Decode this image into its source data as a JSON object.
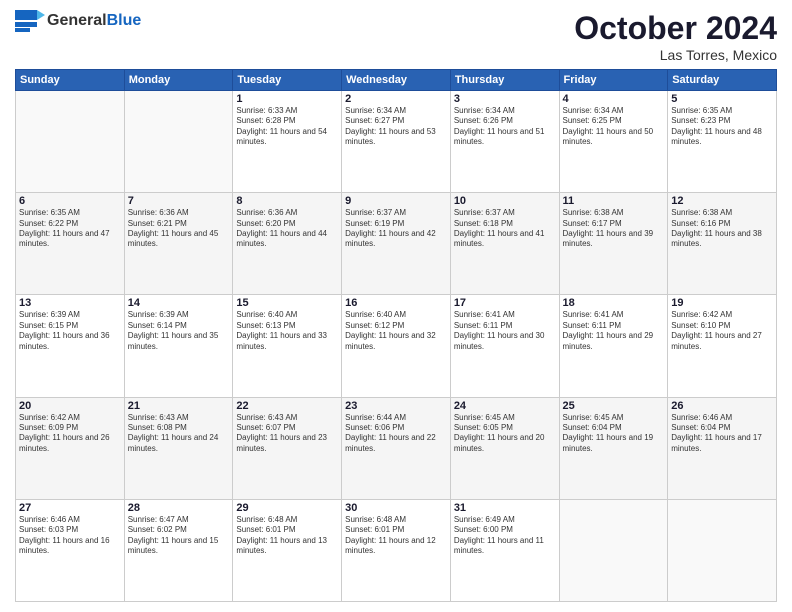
{
  "logo": {
    "general": "General",
    "blue": "Blue"
  },
  "title": "October 2024",
  "location": "Las Torres, Mexico",
  "days_header": [
    "Sunday",
    "Monday",
    "Tuesday",
    "Wednesday",
    "Thursday",
    "Friday",
    "Saturday"
  ],
  "weeks": [
    [
      {
        "day": "",
        "info": ""
      },
      {
        "day": "",
        "info": ""
      },
      {
        "day": "1",
        "info": "Sunrise: 6:33 AM\nSunset: 6:28 PM\nDaylight: 11 hours and 54 minutes."
      },
      {
        "day": "2",
        "info": "Sunrise: 6:34 AM\nSunset: 6:27 PM\nDaylight: 11 hours and 53 minutes."
      },
      {
        "day": "3",
        "info": "Sunrise: 6:34 AM\nSunset: 6:26 PM\nDaylight: 11 hours and 51 minutes."
      },
      {
        "day": "4",
        "info": "Sunrise: 6:34 AM\nSunset: 6:25 PM\nDaylight: 11 hours and 50 minutes."
      },
      {
        "day": "5",
        "info": "Sunrise: 6:35 AM\nSunset: 6:23 PM\nDaylight: 11 hours and 48 minutes."
      }
    ],
    [
      {
        "day": "6",
        "info": "Sunrise: 6:35 AM\nSunset: 6:22 PM\nDaylight: 11 hours and 47 minutes."
      },
      {
        "day": "7",
        "info": "Sunrise: 6:36 AM\nSunset: 6:21 PM\nDaylight: 11 hours and 45 minutes."
      },
      {
        "day": "8",
        "info": "Sunrise: 6:36 AM\nSunset: 6:20 PM\nDaylight: 11 hours and 44 minutes."
      },
      {
        "day": "9",
        "info": "Sunrise: 6:37 AM\nSunset: 6:19 PM\nDaylight: 11 hours and 42 minutes."
      },
      {
        "day": "10",
        "info": "Sunrise: 6:37 AM\nSunset: 6:18 PM\nDaylight: 11 hours and 41 minutes."
      },
      {
        "day": "11",
        "info": "Sunrise: 6:38 AM\nSunset: 6:17 PM\nDaylight: 11 hours and 39 minutes."
      },
      {
        "day": "12",
        "info": "Sunrise: 6:38 AM\nSunset: 6:16 PM\nDaylight: 11 hours and 38 minutes."
      }
    ],
    [
      {
        "day": "13",
        "info": "Sunrise: 6:39 AM\nSunset: 6:15 PM\nDaylight: 11 hours and 36 minutes."
      },
      {
        "day": "14",
        "info": "Sunrise: 6:39 AM\nSunset: 6:14 PM\nDaylight: 11 hours and 35 minutes."
      },
      {
        "day": "15",
        "info": "Sunrise: 6:40 AM\nSunset: 6:13 PM\nDaylight: 11 hours and 33 minutes."
      },
      {
        "day": "16",
        "info": "Sunrise: 6:40 AM\nSunset: 6:12 PM\nDaylight: 11 hours and 32 minutes."
      },
      {
        "day": "17",
        "info": "Sunrise: 6:41 AM\nSunset: 6:11 PM\nDaylight: 11 hours and 30 minutes."
      },
      {
        "day": "18",
        "info": "Sunrise: 6:41 AM\nSunset: 6:11 PM\nDaylight: 11 hours and 29 minutes."
      },
      {
        "day": "19",
        "info": "Sunrise: 6:42 AM\nSunset: 6:10 PM\nDaylight: 11 hours and 27 minutes."
      }
    ],
    [
      {
        "day": "20",
        "info": "Sunrise: 6:42 AM\nSunset: 6:09 PM\nDaylight: 11 hours and 26 minutes."
      },
      {
        "day": "21",
        "info": "Sunrise: 6:43 AM\nSunset: 6:08 PM\nDaylight: 11 hours and 24 minutes."
      },
      {
        "day": "22",
        "info": "Sunrise: 6:43 AM\nSunset: 6:07 PM\nDaylight: 11 hours and 23 minutes."
      },
      {
        "day": "23",
        "info": "Sunrise: 6:44 AM\nSunset: 6:06 PM\nDaylight: 11 hours and 22 minutes."
      },
      {
        "day": "24",
        "info": "Sunrise: 6:45 AM\nSunset: 6:05 PM\nDaylight: 11 hours and 20 minutes."
      },
      {
        "day": "25",
        "info": "Sunrise: 6:45 AM\nSunset: 6:04 PM\nDaylight: 11 hours and 19 minutes."
      },
      {
        "day": "26",
        "info": "Sunrise: 6:46 AM\nSunset: 6:04 PM\nDaylight: 11 hours and 17 minutes."
      }
    ],
    [
      {
        "day": "27",
        "info": "Sunrise: 6:46 AM\nSunset: 6:03 PM\nDaylight: 11 hours and 16 minutes."
      },
      {
        "day": "28",
        "info": "Sunrise: 6:47 AM\nSunset: 6:02 PM\nDaylight: 11 hours and 15 minutes."
      },
      {
        "day": "29",
        "info": "Sunrise: 6:48 AM\nSunset: 6:01 PM\nDaylight: 11 hours and 13 minutes."
      },
      {
        "day": "30",
        "info": "Sunrise: 6:48 AM\nSunset: 6:01 PM\nDaylight: 11 hours and 12 minutes."
      },
      {
        "day": "31",
        "info": "Sunrise: 6:49 AM\nSunset: 6:00 PM\nDaylight: 11 hours and 11 minutes."
      },
      {
        "day": "",
        "info": ""
      },
      {
        "day": "",
        "info": ""
      }
    ]
  ]
}
